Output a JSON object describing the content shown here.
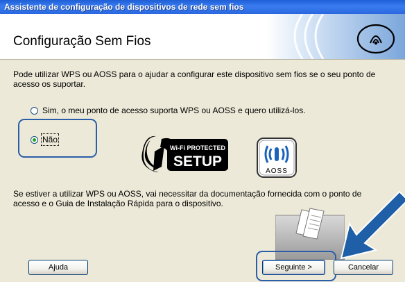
{
  "window": {
    "title": "Assistente de configuração de dispositivos de rede sem fios"
  },
  "header": {
    "title": "Configuração Sem Fios",
    "graphic_icon": "wireless-signal-icon"
  },
  "intro": {
    "text": "Pode utilizar WPS ou AOSS para o ajudar a configurar este dispositivo sem fios se o seu ponto de acesso os suportar."
  },
  "options": [
    {
      "label": "Sim, o meu ponto de acesso suporta WPS ou AOSS e quero utilizá-los.",
      "checked": false
    },
    {
      "label": "Não",
      "checked": true
    }
  ],
  "logos": {
    "wps_top": "Wi-Fi PROTECTED",
    "wps_bottom": "SETUP",
    "aoss": "AOSS"
  },
  "note": {
    "text": "Se estiver a utilizar WPS ou AOSS, vai necessitar da documentação fornecida com o ponto de acesso e o Guia de Instalação Rápida para o dispositivo."
  },
  "buttons": {
    "help": "Ajuda",
    "next": "Seguinte >",
    "cancel": "Cancelar"
  },
  "colors": {
    "titlebar": "#2a67df",
    "highlight": "#2b5ea8",
    "arrow": "#1f5fa8",
    "radio_checked": "#21a121"
  }
}
